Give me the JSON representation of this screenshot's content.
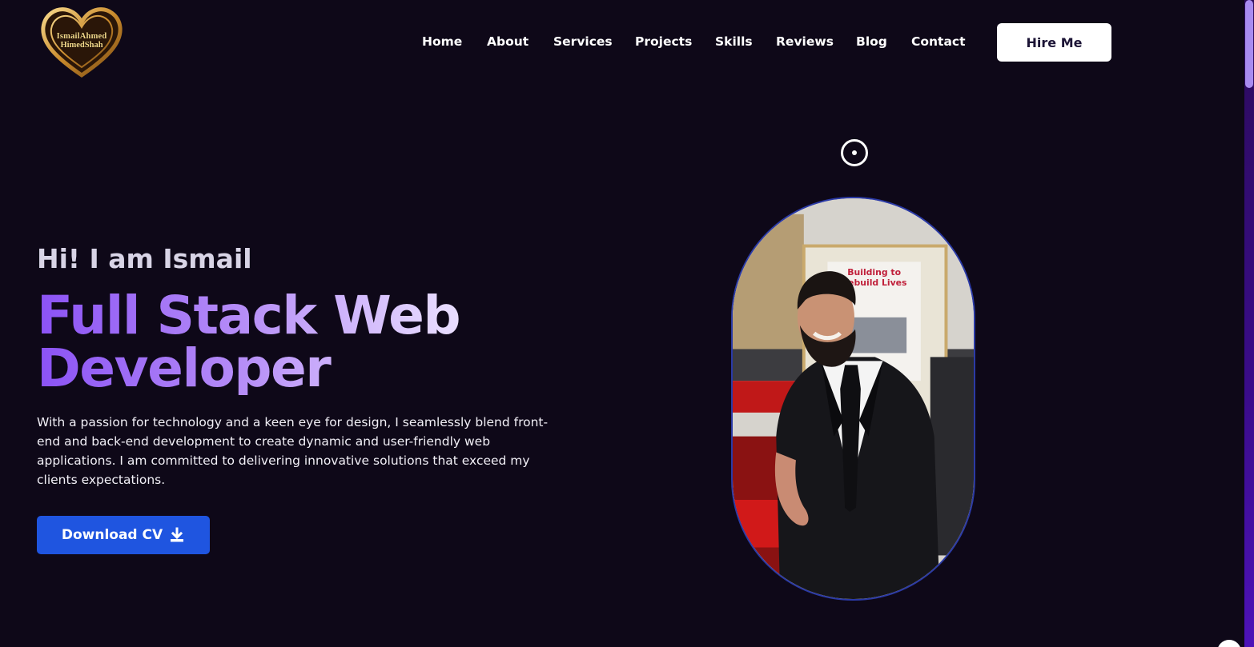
{
  "logo": {
    "line1": "IsmailAhmed",
    "line2": "HimedShah"
  },
  "nav": {
    "items": [
      "Home",
      "About",
      "Services",
      "Projects",
      "Skills",
      "Reviews",
      "Blog",
      "Contact"
    ],
    "hire_label": "Hire Me"
  },
  "hero": {
    "greeting": "Hi! I am Ismail",
    "title_line1": "Full Stack Web",
    "title_line2": "Developer",
    "description": "With a passion for technology and a keen eye for design, I seamlessly blend front-end and back-end development to create dynamic and user-friendly web applications. I am committed to delivering innovative solutions that exceed my clients expectations.",
    "cv_label": "Download CV",
    "cv_icon": "download-icon"
  },
  "portrait": {
    "poster_line1": "Building to",
    "poster_line2": "Rebuild Lives"
  },
  "colors": {
    "background": "#0e0818",
    "accent_purple": "#8b52f5",
    "button_blue": "#1f55e0",
    "scrollbar_thumb": "#a88bf0"
  }
}
